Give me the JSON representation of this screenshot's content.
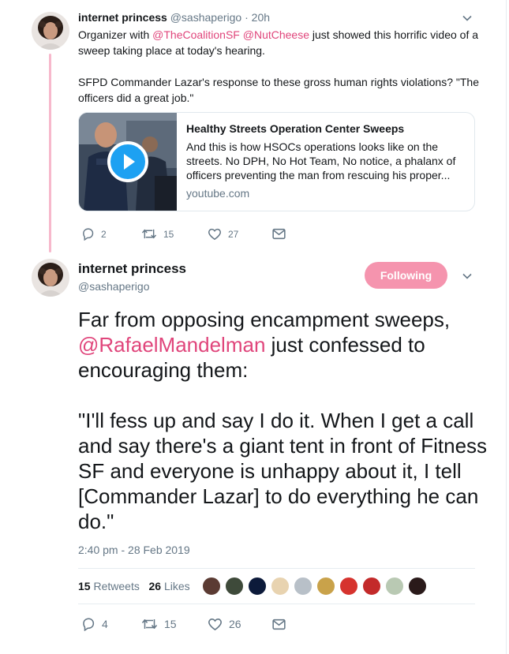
{
  "colors": {
    "accent": "#e0457b",
    "follow_button": "#f594ae",
    "thread_line": "#f7b8cc",
    "text_muted": "#657786"
  },
  "parent": {
    "name": "internet princess",
    "handle": "@sashaperigo",
    "dot": "·",
    "time": "20h",
    "text_pre": "Organizer with ",
    "mention1": "@TheCoalitionSF",
    "mention2": "@NutCheese",
    "text_post": " just showed this horrific video of a sweep taking place at today's hearing.",
    "text_p2": "SFPD Commander Lazar's response to these gross human rights violations? \"The officers did a great job.\"",
    "card": {
      "title": "Healthy Streets Operation Center Sweeps",
      "description": "And this is how HSOCs operations looks like on the streets. No DPH, No Hot Team, No notice, a phalanx of officers preventing the man from rescuing his proper...",
      "domain": "youtube.com"
    },
    "actions": {
      "replies": "2",
      "retweets": "15",
      "likes": "27"
    }
  },
  "main": {
    "name": "internet princess",
    "handle": "@sashaperigo",
    "follow_label": "Following",
    "text_pre": "Far from opposing encampment sweeps, ",
    "mention": "@RafaelMandelman",
    "text_post": " just confessed to encouraging them:",
    "quote": "\"I'll fess up and say I do it. When I get a call and say there's a giant tent in front of Fitness SF and everyone is unhappy about it, I tell [Commander Lazar] to do everything he can do.\"",
    "timestamp": "2:40 pm - 28 Feb 2019",
    "retweets_count": "15",
    "retweets_label": "Retweets",
    "likes_count": "26",
    "likes_label": "Likes",
    "actions": {
      "replies": "4",
      "retweets": "15",
      "likes": "26"
    }
  },
  "icons": {
    "reply": "reply-icon",
    "retweet": "retweet-icon",
    "like": "heart-icon",
    "dm": "envelope-icon",
    "more": "chevron-down-icon",
    "play": "play-icon"
  }
}
